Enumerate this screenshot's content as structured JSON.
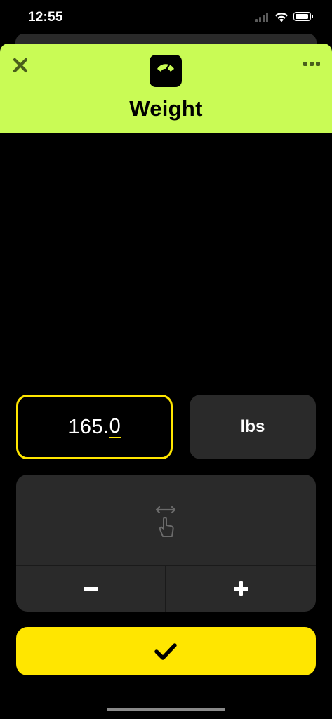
{
  "status_bar": {
    "time": "12:55"
  },
  "header": {
    "title": "Weight",
    "accent_color": "#c9fb55",
    "icon": "scale-icon",
    "close_icon": "close-icon",
    "more_icon": "more-icon"
  },
  "entry": {
    "value_main": "165.",
    "value_last_digit": "0",
    "unit_label": "lbs",
    "focus_color": "#ffe600"
  },
  "stepper": {
    "swipe_icon": "swipe-gesture-icon",
    "decrement_icon": "minus-icon",
    "increment_icon": "plus-icon"
  },
  "confirm": {
    "icon": "checkmark-icon",
    "color": "#ffe600"
  }
}
